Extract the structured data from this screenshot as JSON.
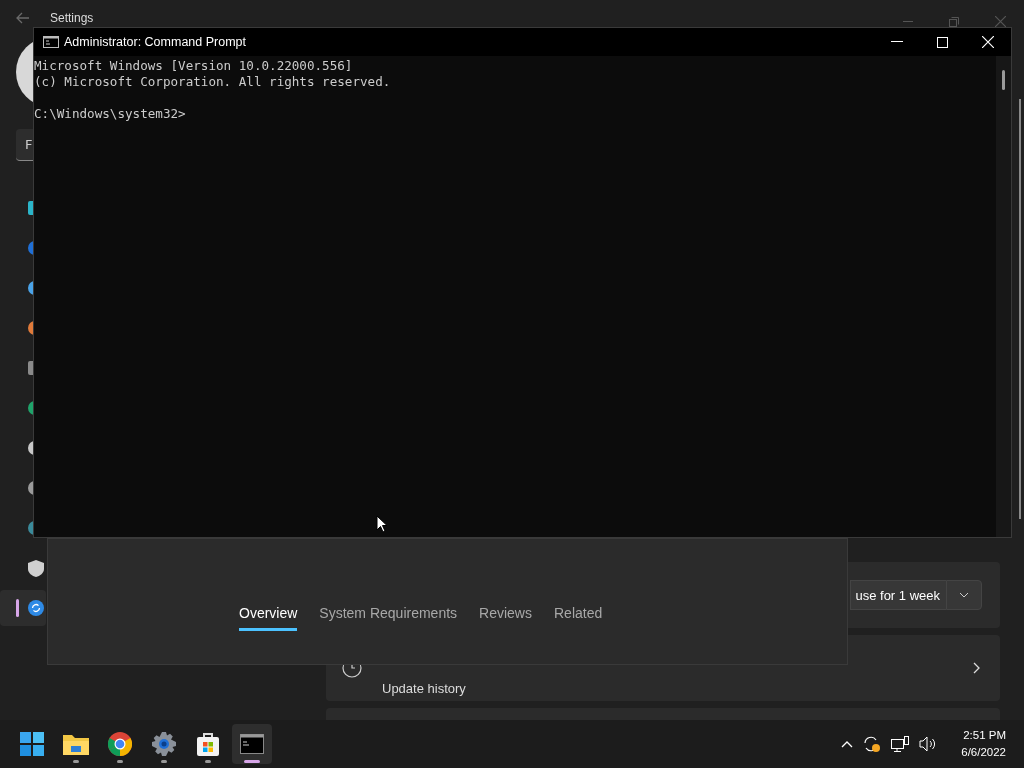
{
  "settings_window": {
    "title": "Settings",
    "search": {
      "value": "F"
    },
    "sidebar": [
      {
        "kind": "tile",
        "color": "#2bb5c9"
      },
      {
        "kind": "dot",
        "color": "#1f6fd6"
      },
      {
        "kind": "dot",
        "color": "#4aa3e8"
      },
      {
        "kind": "dot",
        "color": "#e07a3a"
      },
      {
        "kind": "tile",
        "color": "#8a8a8a"
      },
      {
        "kind": "dot",
        "color": "#1fa36a"
      },
      {
        "kind": "dot",
        "color": "#c8c8c8"
      },
      {
        "kind": "dot",
        "color": "#9a9a9a"
      },
      {
        "kind": "dot",
        "color": "#3a8a9a"
      },
      {
        "kind": "shield",
        "color": "#d0d0d0",
        "selected": false
      },
      {
        "kind": "update",
        "color": "#2e8ae6",
        "selected": true
      }
    ],
    "pause_button": {
      "label": "use for 1 week"
    },
    "update_history": {
      "label": "Update history"
    }
  },
  "cmd_window": {
    "title": "Administrator: Command Prompt",
    "output": [
      "Microsoft Windows [Version 10.0.22000.556]",
      "(c) Microsoft Corporation. All rights reserved."
    ],
    "prompt": "C:\\Windows\\system32>"
  },
  "store_panel": {
    "tabs": [
      {
        "label": "Overview",
        "selected": true
      },
      {
        "label": "System Requirements",
        "selected": false
      },
      {
        "label": "Reviews",
        "selected": false
      },
      {
        "label": "Related",
        "selected": false
      }
    ]
  },
  "taskbar": {
    "apps": [
      {
        "kind": "start",
        "running": false,
        "selected": false
      },
      {
        "kind": "files",
        "running": true,
        "selected": false
      },
      {
        "kind": "chrome",
        "running": true,
        "selected": false
      },
      {
        "kind": "settings",
        "running": true,
        "selected": false
      },
      {
        "kind": "store",
        "running": true,
        "selected": false
      },
      {
        "kind": "terminal",
        "running": true,
        "selected": true
      }
    ],
    "time": "2:51 PM",
    "date": "6/6/2022"
  }
}
